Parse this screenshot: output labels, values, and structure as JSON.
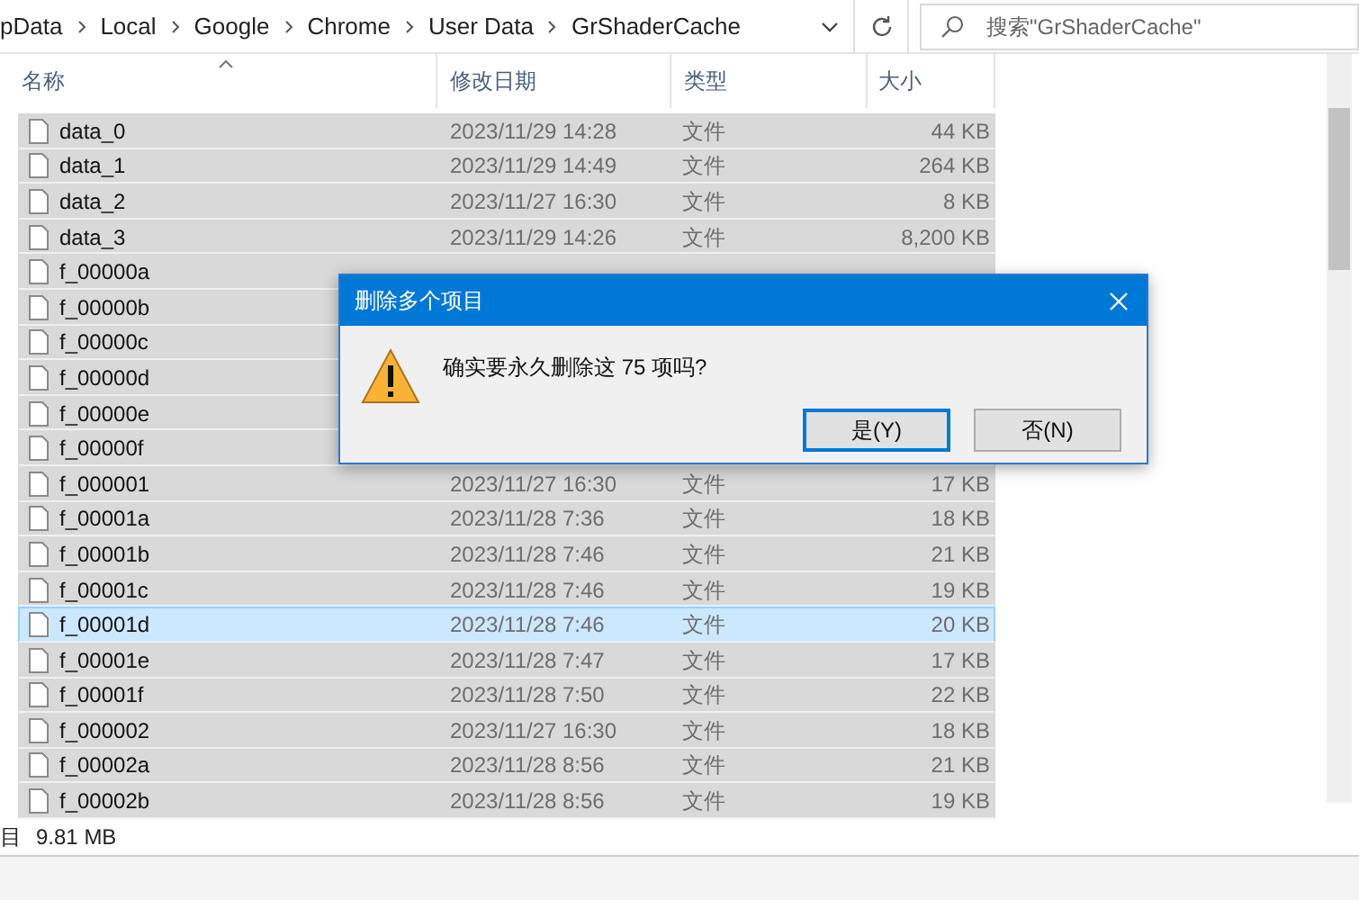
{
  "address_bar": {
    "breadcrumbs": [
      "pData",
      "Local",
      "Google",
      "Chrome",
      "User Data",
      "GrShaderCache"
    ]
  },
  "search": {
    "placeholder": "搜索\"GrShaderCache\""
  },
  "table": {
    "columns": [
      "名称",
      "修改日期",
      "类型",
      "大小"
    ],
    "rows": [
      {
        "name": "data_0",
        "date": "2023/11/29 14:28",
        "type": "文件",
        "size": "44 KB",
        "selected": true,
        "focused": false
      },
      {
        "name": "data_1",
        "date": "2023/11/29 14:49",
        "type": "文件",
        "size": "264 KB",
        "selected": true,
        "focused": false
      },
      {
        "name": "data_2",
        "date": "2023/11/27 16:30",
        "type": "文件",
        "size": "8 KB",
        "selected": true,
        "focused": false
      },
      {
        "name": "data_3",
        "date": "2023/11/29 14:26",
        "type": "文件",
        "size": "8,200 KB",
        "selected": true,
        "focused": false
      },
      {
        "name": "f_00000a",
        "selected": true,
        "focused": false
      },
      {
        "name": "f_00000b",
        "selected": true,
        "focused": false
      },
      {
        "name": "f_00000c",
        "selected": true,
        "focused": false
      },
      {
        "name": "f_00000d",
        "selected": true,
        "focused": false
      },
      {
        "name": "f_00000e",
        "selected": true,
        "focused": false
      },
      {
        "name": "f_00000f",
        "selected": true,
        "focused": false
      },
      {
        "name": "f_000001",
        "date": "2023/11/27 16:30",
        "type": "文件",
        "size": "17 KB",
        "selected": true,
        "focused": false
      },
      {
        "name": "f_00001a",
        "date": "2023/11/28 7:36",
        "type": "文件",
        "size": "18 KB",
        "selected": true,
        "focused": false
      },
      {
        "name": "f_00001b",
        "date": "2023/11/28 7:46",
        "type": "文件",
        "size": "21 KB",
        "selected": true,
        "focused": false
      },
      {
        "name": "f_00001c",
        "date": "2023/11/28 7:46",
        "type": "文件",
        "size": "19 KB",
        "selected": true,
        "focused": false
      },
      {
        "name": "f_00001d",
        "date": "2023/11/28 7:46",
        "type": "文件",
        "size": "20 KB",
        "selected": true,
        "focused": true
      },
      {
        "name": "f_00001e",
        "date": "2023/11/28 7:47",
        "type": "文件",
        "size": "17 KB",
        "selected": true,
        "focused": false
      },
      {
        "name": "f_00001f",
        "date": "2023/11/28 7:50",
        "type": "文件",
        "size": "22 KB",
        "selected": true,
        "focused": false
      },
      {
        "name": "f_000002",
        "date": "2023/11/27 16:30",
        "type": "文件",
        "size": "18 KB",
        "selected": true,
        "focused": false
      },
      {
        "name": "f_00002a",
        "date": "2023/11/28 8:56",
        "type": "文件",
        "size": "21 KB",
        "selected": true,
        "focused": false
      },
      {
        "name": "f_00002b",
        "date": "2023/11/28 8:56",
        "type": "文件",
        "size": "19 KB",
        "selected": true,
        "focused": false
      }
    ]
  },
  "status_bar": {
    "selection": "目",
    "size": "9.81 MB"
  },
  "dialog": {
    "title": "删除多个项目",
    "message": "确实要永久删除这 75 项吗?",
    "buttons": [
      {
        "label": "是(Y)",
        "default": true
      },
      {
        "label": "否(N)",
        "default": false
      }
    ]
  }
}
